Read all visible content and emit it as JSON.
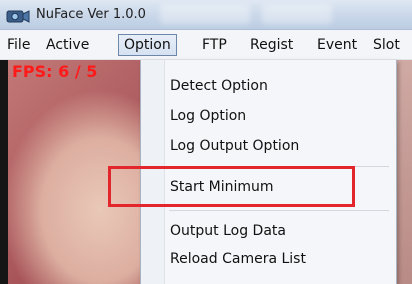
{
  "window": {
    "title": "NuFace Ver 1.0.0"
  },
  "menubar": {
    "items": [
      {
        "label": "File"
      },
      {
        "label": "Active"
      },
      {
        "label": "Option"
      },
      {
        "label": "FTP"
      },
      {
        "label": "Regist"
      },
      {
        "label": "Event"
      },
      {
        "label": "Slot"
      }
    ],
    "open_menu": "Option"
  },
  "video": {
    "fps_text": "FPS: 6 / 5"
  },
  "option_menu": {
    "items": [
      {
        "label": "Detect Option"
      },
      {
        "label": "Log Option"
      },
      {
        "label": "Log Output Option"
      },
      {
        "label": "Start Minimum",
        "highlighted": true
      },
      {
        "label": "Output Log Data"
      },
      {
        "label": "Reload Camera List"
      }
    ]
  },
  "colors": {
    "highlight_border": "#e3262b",
    "fps_text": "#ff1a1a"
  },
  "icons": {
    "app_icon": "camera-icon"
  }
}
